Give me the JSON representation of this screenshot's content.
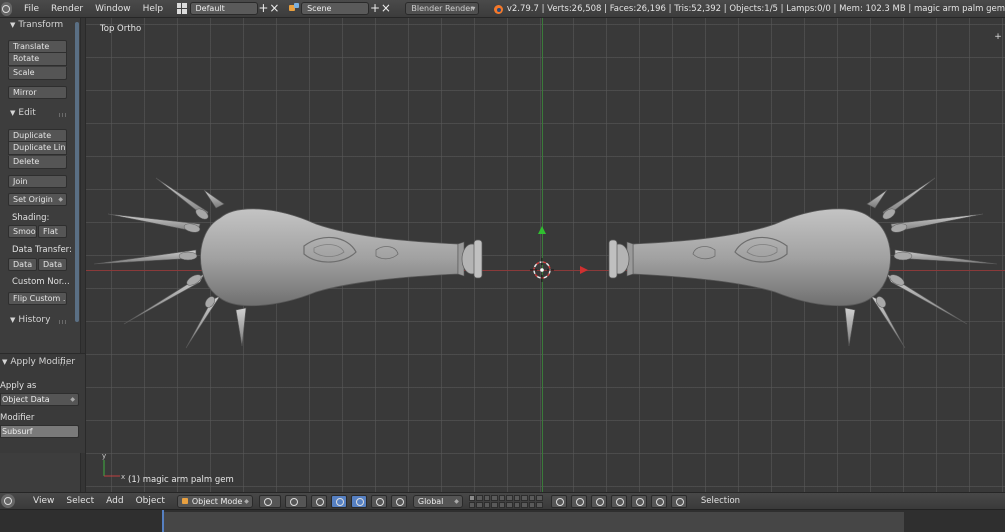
{
  "header": {
    "menus": [
      "File",
      "Render",
      "Window",
      "Help"
    ],
    "layout": "Default",
    "scene": "Scene",
    "engine": "Blender Render",
    "stats": "v2.79.7 | Verts:26,508 | Faces:26,196 | Tris:52,392 | Objects:1/5 | Lamps:0/0 | Mem: 102.3 MB | magic arm palm gem"
  },
  "tool_shelf": {
    "transform": {
      "title": "Transform",
      "translate": "Translate",
      "rotate": "Rotate",
      "scale": "Scale",
      "mirror": "Mirror"
    },
    "edit": {
      "title": "Edit",
      "duplicate": "Duplicate",
      "duplicate_linked": "Duplicate Lin...",
      "delete": "Delete",
      "join": "Join",
      "set_origin": "Set Origin",
      "shading_label": "Shading:",
      "smooth": "Smoo",
      "flat": "Flat",
      "data_transfer_label": "Data Transfer:",
      "data_1": "Data",
      "data_2": "Data",
      "custom_normals_label": "Custom Nor...",
      "flip_custom": "Flip Custom ..."
    },
    "history": {
      "title": "History"
    }
  },
  "operator": {
    "title": "Apply Modifier",
    "apply_as_label": "Apply as",
    "apply_as_value": "Object Data",
    "modifier_label": "Modifier",
    "modifier_value": "Subsurf"
  },
  "viewport": {
    "view_label": "Top Ortho",
    "object_label": "(1) magic arm palm gem",
    "colors": {
      "x_axis": "#8a3a3a",
      "y_axis": "#3a7a3a",
      "mesh": "#9c9c9c"
    }
  },
  "view_header": {
    "menus": [
      "View",
      "Select",
      "Add",
      "Object"
    ],
    "mode": "Object Mode",
    "orientation": "Global",
    "selection_label": "Selection"
  }
}
